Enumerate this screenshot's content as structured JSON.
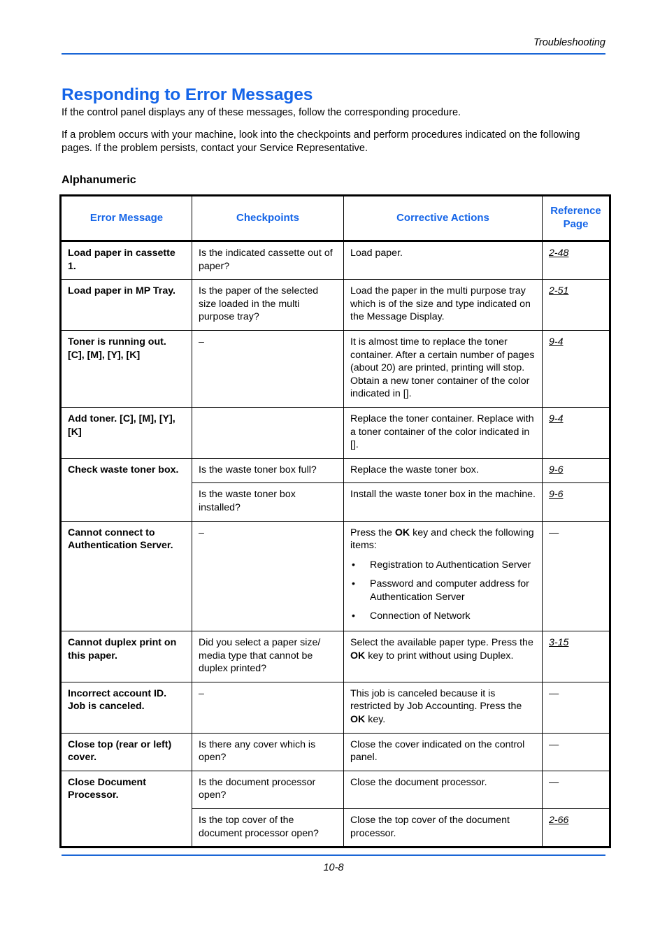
{
  "header": {
    "running_head": "Troubleshooting"
  },
  "title": "Responding to Error Messages",
  "intro": {
    "paragraph1": "If the control panel displays any of these messages, follow the corresponding procedure.",
    "paragraph2": "If a problem occurs with your machine, look into the checkpoints and perform procedures indicated on the following pages. If the problem persists, contact your Service Representative."
  },
  "subheading": "Alphanumeric",
  "table": {
    "columns": [
      "Error Message",
      "Checkpoints",
      "Corrective Actions",
      "Reference Page"
    ],
    "rows": [
      {
        "error_message": "Load paper in cassette 1.",
        "checkpoints": "Is the indicated cassette out of paper?",
        "corrective_actions": "Load paper.",
        "reference_page": "2-48"
      },
      {
        "error_message": "Load paper in MP Tray.",
        "checkpoints": "Is the paper of the selected size loaded in the multi purpose tray?",
        "corrective_actions": "Load the paper in the multi purpose tray which is of the size and type indicated on the Message Display.",
        "reference_page": "2-51"
      },
      {
        "error_message": "Toner is running out. [C], [M], [Y], [K]",
        "checkpoints": "–",
        "corrective_actions": "It is almost time to replace the toner container. After a certain number of pages (about 20) are printed, printing will stop. Obtain a new toner container of the color indicated in [].",
        "reference_page": "9-4"
      },
      {
        "error_message": "Add toner. [C], [M], [Y], [K]",
        "checkpoints": "",
        "corrective_actions": "Replace the toner container. Replace with a toner container of the color indicated in [].",
        "reference_page": "9-4"
      },
      {
        "error_message": "Check waste toner box.",
        "checkpoints": "Is the waste toner box full?",
        "corrective_actions": "Replace the waste toner box.",
        "reference_page": "9-6"
      },
      {
        "error_message": "",
        "checkpoints": "Is the waste toner box installed?",
        "corrective_actions": "Install the waste toner box in the machine.",
        "reference_page": "9-6"
      },
      {
        "error_message": "Cannot connect to Authentication Server.",
        "checkpoints": "–",
        "corrective_actions_lead": "Press the OK key and check the following items:",
        "corrective_actions_lead_pre": "Press the ",
        "corrective_actions_lead_bold": "OK",
        "corrective_actions_lead_post": " key and check the following items:",
        "corrective_actions_bullets": [
          "Registration to Authentication Server",
          "Password and computer address for Authentication Server",
          "Connection of Network"
        ],
        "reference_page": "—"
      },
      {
        "error_message": "Cannot duplex print on this paper.",
        "checkpoints": "Did you select a paper size/ media type that cannot be duplex printed?",
        "corrective_actions_pre": "Select the available paper type. Press the ",
        "corrective_actions_bold": "OK",
        "corrective_actions_post": " key to print without using Duplex.",
        "reference_page": "3-15"
      },
      {
        "error_message": "Incorrect account ID. Job is canceled.",
        "checkpoints": "–",
        "corrective_actions_pre": "This job is canceled because it is restricted by Job Accounting. Press the ",
        "corrective_actions_bold": "OK",
        "corrective_actions_post": " key.",
        "reference_page": "—"
      },
      {
        "error_message": "Close top (rear or left) cover.",
        "checkpoints": "Is there any cover which is open?",
        "corrective_actions": "Close the cover indicated on the control panel.",
        "reference_page": "—"
      },
      {
        "error_message": "Close Document Processor.",
        "checkpoints": "Is the document processor open?",
        "corrective_actions": "Close the document processor.",
        "reference_page": "—"
      },
      {
        "error_message": "",
        "checkpoints": "Is the top cover of the document processor open?",
        "corrective_actions": "Close the top cover of the document processor.",
        "reference_page": "2-66"
      }
    ]
  },
  "footer": {
    "page_number": "10-8"
  },
  "colors": {
    "accent_blue": "#1565e8",
    "rule_blue": "#1a66d6",
    "text_black": "#000000"
  }
}
